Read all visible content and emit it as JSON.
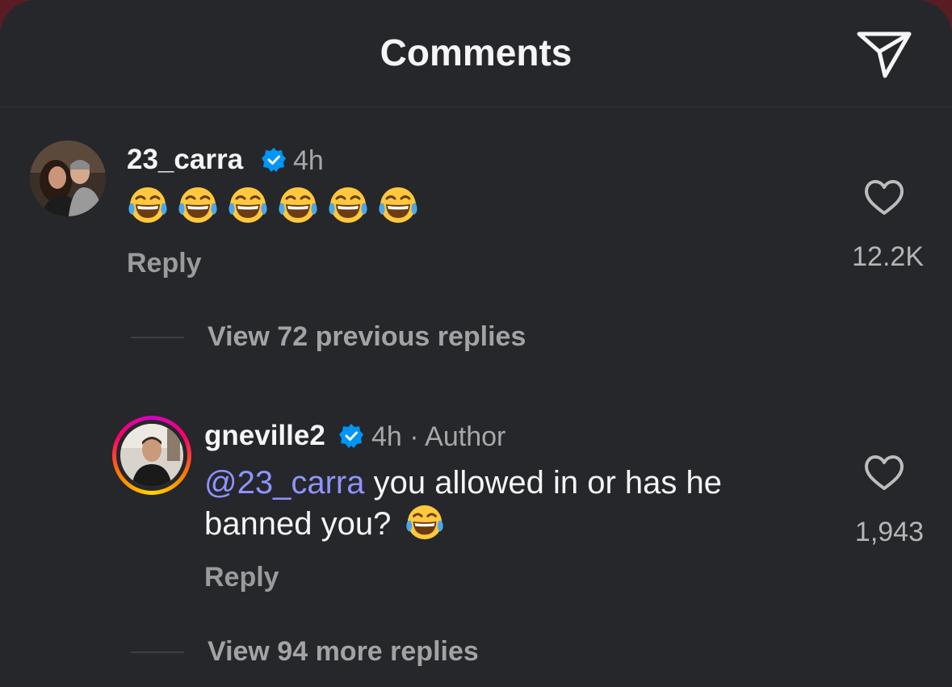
{
  "header": {
    "title": "Comments",
    "send_icon": "paper-plane-icon"
  },
  "comments": [
    {
      "username": "23_carra",
      "verified": true,
      "time": "4h",
      "emoji": "face-with-tears-of-joy",
      "emoji_count": 6,
      "reply_label": "Reply",
      "like_count": "12.2K",
      "view_replies": "View 72 previous replies"
    },
    {
      "username": "gneville2",
      "verified": true,
      "time": "4h",
      "author_tag": "· Author",
      "mention": "@23_carra",
      "text_line1": " you allowed in or has he",
      "text_line2": "banned you?",
      "reply_label": "Reply",
      "like_count": "1,943",
      "view_replies": "View 94 more replies"
    }
  ],
  "colors": {
    "background": "#25272b",
    "mention": "#8f93ff",
    "verified_badge": "#0095f6",
    "secondary_text": "#a8a8a8"
  }
}
